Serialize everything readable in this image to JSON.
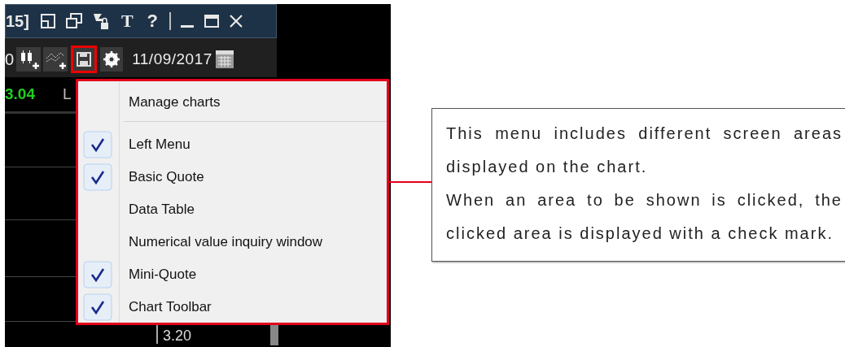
{
  "window": {
    "title": "15]",
    "tool_letters": [
      "T",
      "?"
    ]
  },
  "toolbar": {
    "value": "0",
    "date": "11/09/2017"
  },
  "quote": {
    "price": "3.04",
    "label": "L"
  },
  "axis": {
    "label": "3.20"
  },
  "menu": {
    "header": "Manage charts",
    "items": [
      {
        "label": "Left Menu",
        "checked": true
      },
      {
        "label": "Basic Quote",
        "checked": true
      },
      {
        "label": "Data Table",
        "checked": false
      },
      {
        "label": "Numerical value inquiry window",
        "checked": false
      },
      {
        "label": "Mini-Quote",
        "checked": true
      },
      {
        "label": "Chart Toolbar",
        "checked": true
      }
    ]
  },
  "callout": {
    "paragraphs": [
      "This menu includes different screen areas displayed on the chart.",
      "When an area to be shown is clicked, the clicked area is displayed with a check mark."
    ]
  }
}
